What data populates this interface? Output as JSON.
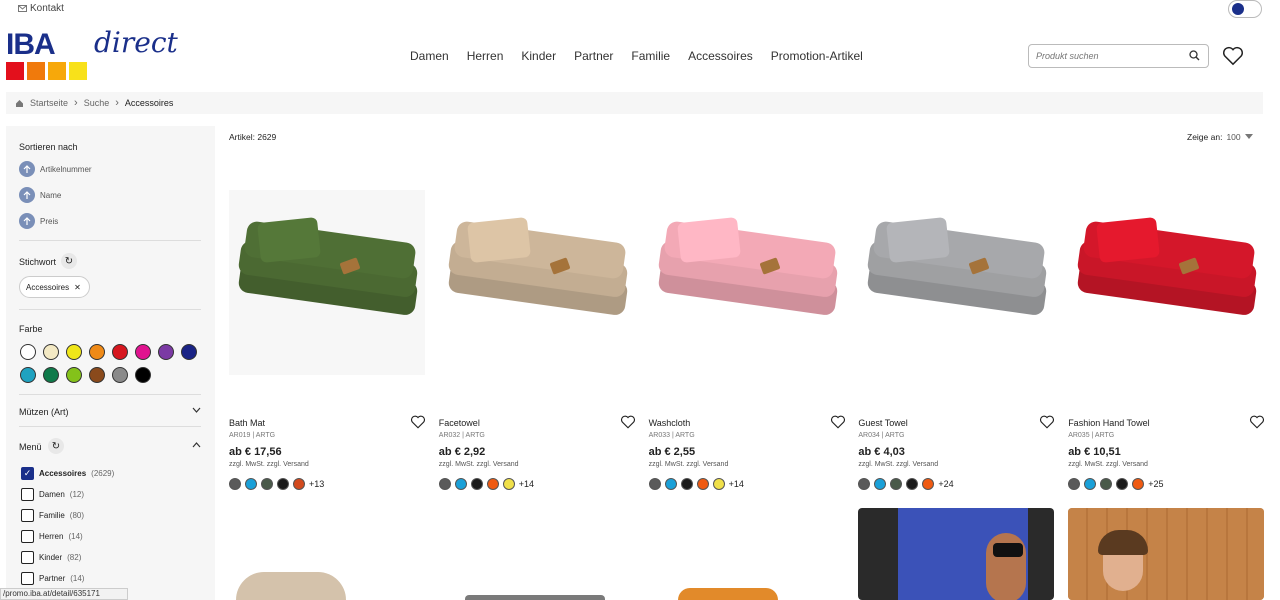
{
  "header": {
    "contact_label": "Kontakt",
    "logo_text": "IBA",
    "logo_script": "direct",
    "nav": [
      "Damen",
      "Herren",
      "Kinder",
      "Partner",
      "Familie",
      "Accessoires",
      "Promotion-Artikel"
    ],
    "search_placeholder": "Produkt suchen"
  },
  "breadcrumb": [
    "Startseite",
    "Suche",
    "Accessoires"
  ],
  "sidebar": {
    "sort_title": "Sortieren nach",
    "sort_options": [
      "Artikelnummer",
      "Name",
      "Preis"
    ],
    "keyword_title": "Stichwort",
    "keyword_chip": "Accessoires",
    "color_title": "Farbe",
    "colors": [
      "#ffffff",
      "#f3e9c4",
      "#f0e619",
      "#ef8a17",
      "#d6171f",
      "#e0138f",
      "#7b3aa4",
      "#1a2385",
      "#1fa2c0",
      "#0f7a4a",
      "#84c21a",
      "#8a4a1c",
      "#8a8a8a",
      "#000000"
    ],
    "muetzen_title": "Mützen (Art)",
    "menu_title": "Menü",
    "menu_items": [
      {
        "label": "Accessoires",
        "count": "(2629)",
        "checked": true
      },
      {
        "label": "Damen",
        "count": "(12)",
        "checked": false
      },
      {
        "label": "Familie",
        "count": "(80)",
        "checked": false
      },
      {
        "label": "Herren",
        "count": "(14)",
        "checked": false
      },
      {
        "label": "Kinder",
        "count": "(82)",
        "checked": false
      },
      {
        "label": "Partner",
        "count": "(14)",
        "checked": false
      }
    ]
  },
  "results": {
    "count_label": "Artikel: 2629",
    "show_label": "Zeige an:",
    "show_value": "100"
  },
  "products": [
    {
      "name": "Bath Mat",
      "sku": "AR019 | ARTG",
      "price": "ab € 17,56",
      "vat": "zzgl. MwSt. zzgl. Versand",
      "colors": [
        "#5a5a5a",
        "#1aa0d8",
        "#4a5a4a",
        "#1a1a1a",
        "#d24a1e"
      ],
      "more": "+13",
      "towel": "#4f6f35"
    },
    {
      "name": "Facetowel",
      "sku": "AR032 | ARTG",
      "price": "ab € 2,92",
      "vat": "zzgl. MwSt. zzgl. Versand",
      "colors": [
        "#5a5a5a",
        "#1aa0d8",
        "#1a1a1a",
        "#ef5a12",
        "#f0e04a"
      ],
      "more": "+14",
      "towel": "#cdb69a"
    },
    {
      "name": "Washcloth",
      "sku": "AR033 | ARTG",
      "price": "ab € 2,55",
      "vat": "zzgl. MwSt. zzgl. Versand",
      "colors": [
        "#5a5a5a",
        "#1aa0d8",
        "#1a1a1a",
        "#ef5a12",
        "#f0e04a"
      ],
      "more": "+14",
      "towel": "#f3a9b6"
    },
    {
      "name": "Guest Towel",
      "sku": "AR034 | ARTG",
      "price": "ab € 4,03",
      "vat": "zzgl. MwSt. zzgl. Versand",
      "colors": [
        "#5a5a5a",
        "#1aa0d8",
        "#4a5a4a",
        "#1a1a1a",
        "#ef5a12"
      ],
      "more": "+24",
      "towel": "#a7a8ab"
    },
    {
      "name": "Fashion Hand Towel",
      "sku": "AR035 | ARTG",
      "price": "ab € 10,51",
      "vat": "zzgl. MwSt. zzgl. Versand",
      "colors": [
        "#5a5a5a",
        "#1aa0d8",
        "#4a5a4a",
        "#1a1a1a",
        "#ef5a12"
      ],
      "more": "+25",
      "towel": "#d4172a"
    }
  ],
  "status_url": "/promo.iba.at/detail/635171"
}
